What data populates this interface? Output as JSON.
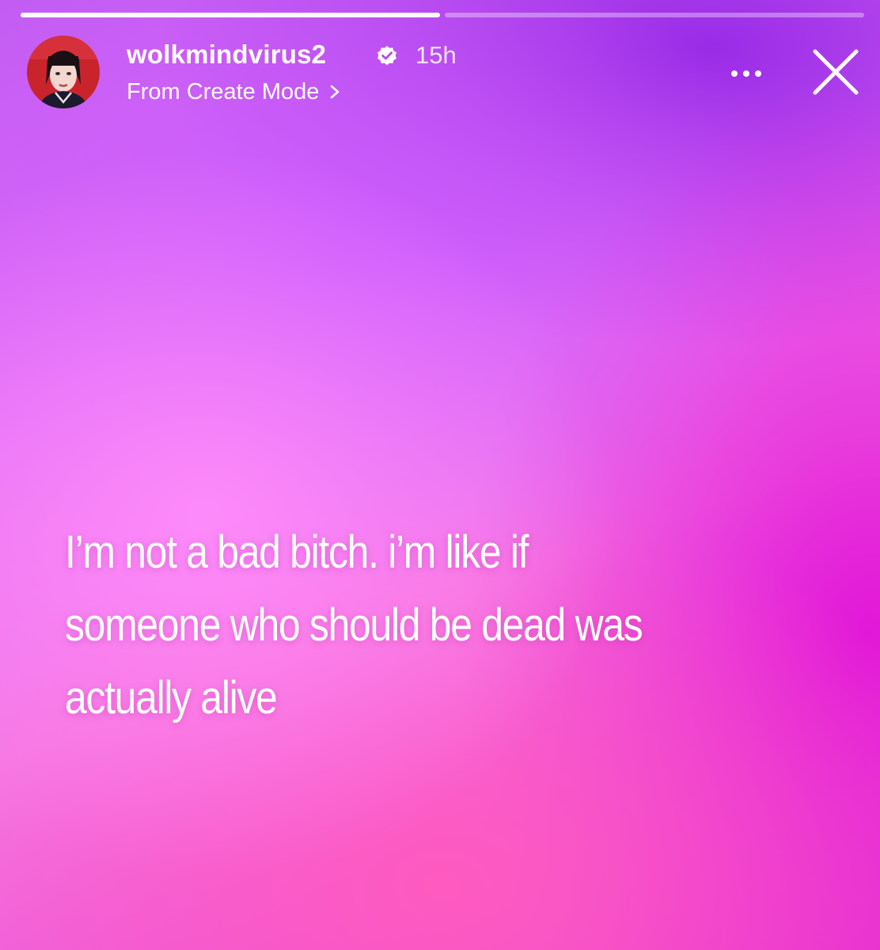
{
  "story": {
    "progress": {
      "segments_total": 2,
      "segments_viewed": 1,
      "current_fraction": 0.0
    },
    "header": {
      "username": "wolkmindvirus2",
      "verified": true,
      "time_ago": "15h",
      "source_label": "From Create Mode",
      "icons": {
        "verified": "verified-badge-icon",
        "source": "chevron-right-icon",
        "more": "more-horizontal-icon",
        "close": "close-icon"
      }
    },
    "text_lines": [
      "I’m not a bad bitch. i’m like if",
      "someone who should be dead was",
      "actually alive"
    ],
    "colors": {
      "text": "#ffffff",
      "gradient_top_right": "#9628e6",
      "gradient_center_left": "#ff8cfa",
      "gradient_bottom_right": "#e114d7"
    }
  }
}
